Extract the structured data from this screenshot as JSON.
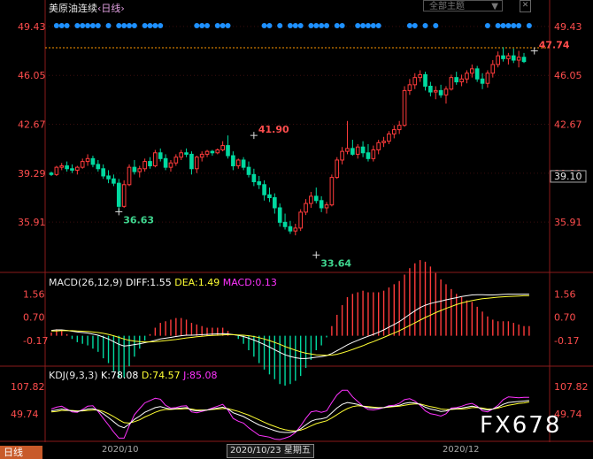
{
  "header": {
    "symbol": "美原油连续",
    "period": "‹日线›",
    "theme_menu": "全部主题",
    "theme_arrow": "▼",
    "close_glyph": "✕"
  },
  "macd_legend": {
    "name": "MACD(26,12,9)",
    "diff": "DIFF:1.55",
    "dea": "DEA:1.49",
    "macd": "MACD:0.13"
  },
  "kdj_legend": {
    "name": "KDJ(9,3,3)",
    "k": "K:78.08",
    "d": "D:74.57",
    "j": "J:85.08"
  },
  "side_tab": "日线",
  "watermark": "FX678",
  "x_axis": {
    "ticks": [
      "2020/10",
      "2020/12"
    ],
    "cursor_label": "2020/10/23 星期五"
  },
  "colors": {
    "up": "#ff3b3b",
    "down": "#00d9a0",
    "axis_label": "#ff4d4d",
    "diff_line": "#ffffff",
    "dea_line": "#ffff33",
    "j_line": "#ff33ff",
    "event_dot": "#1e90ff",
    "last_price_line": "#ff9900"
  },
  "chart_data": [
    {
      "type": "candlestick",
      "name": "美原油连续",
      "y_ticks_left": [
        "49.43",
        "46.05",
        "42.67",
        "39.29",
        "35.91"
      ],
      "y_ticks_right": [
        "49.43",
        "46.05",
        "42.67",
        "39.29",
        "39.10",
        "35.91"
      ],
      "ylim": [
        32.5,
        50.4
      ],
      "last_price": "39.10",
      "annotations": [
        {
          "label": "41.90",
          "x_index": 39,
          "y": 41.9,
          "kind": "high"
        },
        {
          "label": "36.63",
          "x_index": 13,
          "y": 36.63,
          "kind": "low"
        },
        {
          "label": "33.64",
          "x_index": 51,
          "y": 33.64,
          "kind": "low"
        },
        {
          "label": "47.74",
          "x_index": 93,
          "y": 47.74,
          "kind": "high"
        }
      ],
      "candles": [
        [
          39.3,
          39.4,
          39.1,
          39.2
        ],
        [
          39.2,
          39.8,
          39.1,
          39.7
        ],
        [
          39.7,
          40.0,
          39.5,
          39.8
        ],
        [
          39.8,
          40.1,
          39.4,
          39.6
        ],
        [
          39.6,
          39.9,
          39.3,
          39.5
        ],
        [
          39.5,
          39.8,
          39.2,
          39.7
        ],
        [
          39.7,
          40.3,
          39.6,
          40.1
        ],
        [
          40.1,
          40.6,
          39.8,
          40.3
        ],
        [
          40.3,
          40.5,
          39.7,
          39.9
        ],
        [
          39.9,
          40.2,
          39.4,
          39.6
        ],
        [
          39.6,
          39.9,
          38.9,
          39.1
        ],
        [
          39.1,
          39.5,
          38.6,
          38.9
        ],
        [
          38.9,
          39.2,
          38.4,
          38.6
        ],
        [
          38.6,
          38.9,
          36.6,
          37.0
        ],
        [
          37.0,
          38.8,
          36.9,
          38.5
        ],
        [
          38.5,
          39.9,
          38.4,
          39.7
        ],
        [
          39.7,
          40.2,
          39.2,
          39.4
        ],
        [
          39.4,
          39.8,
          39.0,
          39.6
        ],
        [
          39.6,
          40.3,
          39.4,
          40.1
        ],
        [
          40.1,
          40.4,
          39.6,
          39.8
        ],
        [
          39.8,
          40.9,
          39.7,
          40.7
        ],
        [
          40.7,
          41.0,
          40.1,
          40.3
        ],
        [
          40.3,
          40.6,
          39.5,
          39.7
        ],
        [
          39.7,
          40.2,
          39.4,
          40.0
        ],
        [
          40.0,
          40.6,
          39.8,
          40.4
        ],
        [
          40.4,
          40.9,
          40.2,
          40.7
        ],
        [
          40.7,
          41.0,
          40.4,
          40.6
        ],
        [
          40.6,
          40.8,
          39.2,
          39.6
        ],
        [
          39.6,
          40.5,
          39.3,
          40.4
        ],
        [
          40.4,
          40.8,
          40.1,
          40.6
        ],
        [
          40.6,
          40.9,
          40.4,
          40.8
        ],
        [
          40.8,
          40.9,
          40.5,
          40.7
        ],
        [
          40.7,
          41.0,
          40.6,
          40.9
        ],
        [
          40.9,
          41.5,
          40.8,
          41.2
        ],
        [
          41.2,
          41.9,
          40.3,
          40.5
        ],
        [
          40.5,
          40.8,
          39.5,
          39.8
        ],
        [
          39.8,
          40.3,
          39.6,
          40.2
        ],
        [
          40.2,
          40.4,
          39.5,
          39.7
        ],
        [
          39.7,
          40.1,
          39.0,
          39.2
        ],
        [
          39.2,
          39.6,
          38.4,
          38.7
        ],
        [
          38.7,
          39.1,
          38.2,
          38.5
        ],
        [
          38.5,
          38.8,
          37.4,
          37.8
        ],
        [
          37.8,
          38.3,
          37.3,
          37.6
        ],
        [
          37.6,
          37.9,
          36.5,
          36.9
        ],
        [
          36.9,
          37.2,
          35.6,
          35.9
        ],
        [
          35.9,
          36.5,
          35.4,
          35.6
        ],
        [
          35.6,
          36.0,
          35.1,
          35.3
        ],
        [
          35.3,
          35.8,
          35.0,
          35.5
        ],
        [
          35.5,
          36.8,
          35.3,
          36.6
        ],
        [
          36.6,
          37.5,
          36.4,
          37.2
        ],
        [
          37.2,
          38.0,
          36.9,
          37.7
        ],
        [
          37.7,
          38.3,
          37.2,
          37.4
        ],
        [
          37.4,
          37.7,
          36.6,
          36.9
        ],
        [
          36.9,
          37.3,
          36.5,
          37.1
        ],
        [
          37.1,
          39.2,
          37.0,
          39.0
        ],
        [
          39.0,
          40.4,
          38.9,
          40.2
        ],
        [
          40.2,
          41.1,
          39.9,
          40.8
        ],
        [
          40.8,
          42.9,
          40.6,
          41.0
        ],
        [
          41.0,
          41.6,
          40.5,
          40.6
        ],
        [
          40.6,
          41.3,
          40.3,
          41.1
        ],
        [
          41.1,
          41.5,
          40.4,
          40.7
        ],
        [
          40.7,
          41.3,
          40.1,
          40.3
        ],
        [
          40.3,
          41.2,
          40.1,
          40.9
        ],
        [
          40.9,
          41.6,
          40.6,
          41.4
        ],
        [
          41.4,
          41.8,
          41.1,
          41.5
        ],
        [
          41.5,
          42.2,
          41.3,
          42.0
        ],
        [
          42.0,
          42.6,
          41.7,
          42.3
        ],
        [
          42.3,
          42.9,
          42.0,
          42.6
        ],
        [
          42.6,
          45.3,
          42.5,
          45.0
        ],
        [
          45.0,
          45.8,
          44.7,
          45.4
        ],
        [
          45.4,
          46.2,
          45.1,
          45.9
        ],
        [
          45.9,
          46.4,
          45.6,
          46.1
        ],
        [
          46.1,
          46.3,
          45.0,
          45.3
        ],
        [
          45.3,
          45.6,
          44.6,
          44.9
        ],
        [
          44.9,
          45.3,
          44.4,
          45.0
        ],
        [
          45.0,
          45.4,
          44.5,
          44.7
        ],
        [
          44.7,
          45.3,
          44.1,
          45.1
        ],
        [
          45.1,
          46.1,
          45.0,
          45.9
        ],
        [
          45.9,
          46.3,
          45.4,
          45.6
        ],
        [
          45.6,
          46.1,
          45.3,
          45.8
        ],
        [
          45.8,
          46.4,
          45.5,
          46.2
        ],
        [
          46.2,
          46.8,
          45.9,
          46.5
        ],
        [
          46.5,
          46.7,
          45.6,
          45.8
        ],
        [
          45.8,
          46.2,
          45.1,
          45.5
        ],
        [
          45.5,
          46.4,
          45.2,
          46.2
        ],
        [
          46.2,
          47.1,
          45.9,
          46.8
        ],
        [
          46.8,
          47.7,
          46.6,
          47.4
        ],
        [
          47.4,
          48.0,
          47.0,
          47.2
        ],
        [
          47.2,
          47.6,
          46.8,
          47.4
        ],
        [
          47.4,
          47.9,
          46.9,
          47.1
        ],
        [
          47.1,
          47.74,
          46.6,
          47.3
        ],
        [
          47.3,
          47.6,
          46.9,
          47.0
        ]
      ],
      "event_markers": [
        1,
        2,
        3,
        5,
        6,
        7,
        8,
        9,
        11,
        13,
        14,
        15,
        16,
        18,
        19,
        20,
        21,
        28,
        29,
        30,
        32,
        33,
        34,
        41,
        42,
        44,
        46,
        47,
        48,
        50,
        51,
        52,
        53,
        55,
        56,
        59,
        60,
        61,
        62,
        63,
        69,
        70,
        72,
        74,
        84,
        86,
        87,
        88,
        89,
        90,
        92
      ]
    },
    {
      "type": "line",
      "name": "MACD(26,12,9)",
      "y_ticks": [
        "1.56",
        "0.70",
        "-0.17"
      ],
      "ylim": [
        -1.1,
        1.9
      ],
      "series": [
        {
          "name": "DIFF",
          "values": [
            0.2,
            0.22,
            0.22,
            0.2,
            0.17,
            0.14,
            0.12,
            0.1,
            0.06,
            0.02,
            -0.05,
            -0.12,
            -0.22,
            -0.32,
            -0.38,
            -0.36,
            -0.33,
            -0.3,
            -0.26,
            -0.22,
            -0.17,
            -0.12,
            -0.09,
            -0.06,
            -0.03,
            0.0,
            0.02,
            0.02,
            0.03,
            0.04,
            0.05,
            0.06,
            0.07,
            0.08,
            0.07,
            0.04,
            0.01,
            -0.03,
            -0.09,
            -0.16,
            -0.24,
            -0.33,
            -0.42,
            -0.52,
            -0.62,
            -0.71,
            -0.77,
            -0.82,
            -0.85,
            -0.85,
            -0.83,
            -0.8,
            -0.78,
            -0.74,
            -0.66,
            -0.56,
            -0.45,
            -0.34,
            -0.25,
            -0.17,
            -0.09,
            -0.02,
            0.05,
            0.13,
            0.22,
            0.32,
            0.42,
            0.53,
            0.66,
            0.8,
            0.93,
            1.05,
            1.14,
            1.2,
            1.25,
            1.29,
            1.34,
            1.38,
            1.42,
            1.46,
            1.49,
            1.52,
            1.53,
            1.53,
            1.52,
            1.52,
            1.53,
            1.54,
            1.55,
            1.55,
            1.55,
            1.55,
            1.55
          ]
        },
        {
          "name": "DEA",
          "values": [
            0.18,
            0.18,
            0.19,
            0.19,
            0.19,
            0.18,
            0.17,
            0.16,
            0.14,
            0.12,
            0.09,
            0.05,
            0.0,
            -0.06,
            -0.12,
            -0.17,
            -0.2,
            -0.22,
            -0.23,
            -0.23,
            -0.22,
            -0.2,
            -0.18,
            -0.16,
            -0.14,
            -0.11,
            -0.08,
            -0.06,
            -0.04,
            -0.02,
            0.0,
            0.01,
            0.02,
            0.03,
            0.04,
            0.04,
            0.03,
            0.02,
            0.0,
            -0.03,
            -0.07,
            -0.12,
            -0.18,
            -0.25,
            -0.32,
            -0.4,
            -0.47,
            -0.54,
            -0.6,
            -0.65,
            -0.68,
            -0.71,
            -0.72,
            -0.73,
            -0.72,
            -0.69,
            -0.64,
            -0.58,
            -0.51,
            -0.44,
            -0.37,
            -0.29,
            -0.22,
            -0.14,
            -0.06,
            0.02,
            0.1,
            0.19,
            0.28,
            0.38,
            0.48,
            0.58,
            0.68,
            0.77,
            0.86,
            0.94,
            1.02,
            1.09,
            1.16,
            1.22,
            1.27,
            1.31,
            1.35,
            1.38,
            1.4,
            1.42,
            1.44,
            1.45,
            1.46,
            1.47,
            1.48,
            1.49,
            1.49
          ]
        }
      ],
      "histogram_note": "MACD = 2 × (DIFF − DEA)"
    },
    {
      "type": "line",
      "name": "KDJ(9,3,3)",
      "y_ticks": [
        "107.82",
        "49.74"
      ],
      "ylim": [
        -5,
        125
      ],
      "series": [
        {
          "name": "K",
          "values": [
            56,
            58,
            60,
            58,
            56,
            55,
            57,
            60,
            61,
            57,
            50,
            42,
            33,
            24,
            20,
            28,
            38,
            45,
            53,
            58,
            63,
            65,
            62,
            60,
            61,
            62,
            63,
            58,
            56,
            57,
            58,
            60,
            62,
            64,
            60,
            52,
            48,
            44,
            38,
            32,
            26,
            22,
            18,
            14,
            11,
            10,
            10,
            12,
            18,
            26,
            34,
            38,
            39,
            42,
            52,
            62,
            70,
            74,
            72,
            70,
            66,
            63,
            62,
            62,
            63,
            65,
            66,
            68,
            72,
            74,
            73,
            70,
            64,
            60,
            58,
            55,
            56,
            60,
            61,
            62,
            64,
            66,
            64,
            60,
            58,
            60,
            64,
            70,
            74,
            75,
            76,
            77,
            78
          ]
        },
        {
          "name": "D",
          "values": [
            54,
            55,
            57,
            57,
            57,
            56,
            56,
            57,
            58,
            58,
            55,
            50,
            44,
            37,
            31,
            30,
            33,
            37,
            43,
            48,
            53,
            57,
            59,
            59,
            60,
            60,
            61,
            60,
            58,
            58,
            58,
            59,
            60,
            61,
            61,
            58,
            55,
            51,
            47,
            42,
            37,
            32,
            27,
            23,
            19,
            16,
            14,
            13,
            15,
            19,
            24,
            29,
            32,
            35,
            41,
            48,
            55,
            61,
            65,
            67,
            66,
            65,
            64,
            63,
            63,
            64,
            65,
            66,
            68,
            70,
            71,
            71,
            68,
            65,
            63,
            60,
            59,
            59,
            60,
            60,
            61,
            63,
            63,
            62,
            60,
            60,
            62,
            65,
            68,
            70,
            72,
            73,
            75
          ]
        },
        {
          "name": "J",
          "values": [
            60,
            64,
            66,
            60,
            54,
            53,
            59,
            66,
            67,
            55,
            40,
            26,
            11,
            -2,
            -2,
            24,
            48,
            61,
            73,
            78,
            83,
            81,
            68,
            62,
            63,
            66,
            67,
            54,
            52,
            55,
            58,
            62,
            66,
            70,
            58,
            40,
            34,
            30,
            20,
            12,
            4,
            2,
            0,
            -4,
            -5,
            -2,
            2,
            10,
            24,
            40,
            54,
            56,
            53,
            56,
            74,
            90,
            100,
            100,
            86,
            76,
            66,
            59,
            58,
            60,
            63,
            67,
            68,
            72,
            80,
            82,
            77,
            68,
            56,
            50,
            48,
            45,
            50,
            62,
            63,
            66,
            70,
            72,
            66,
            56,
            54,
            60,
            68,
            80,
            86,
            85,
            84,
            85,
            85
          ]
        }
      ]
    }
  ]
}
